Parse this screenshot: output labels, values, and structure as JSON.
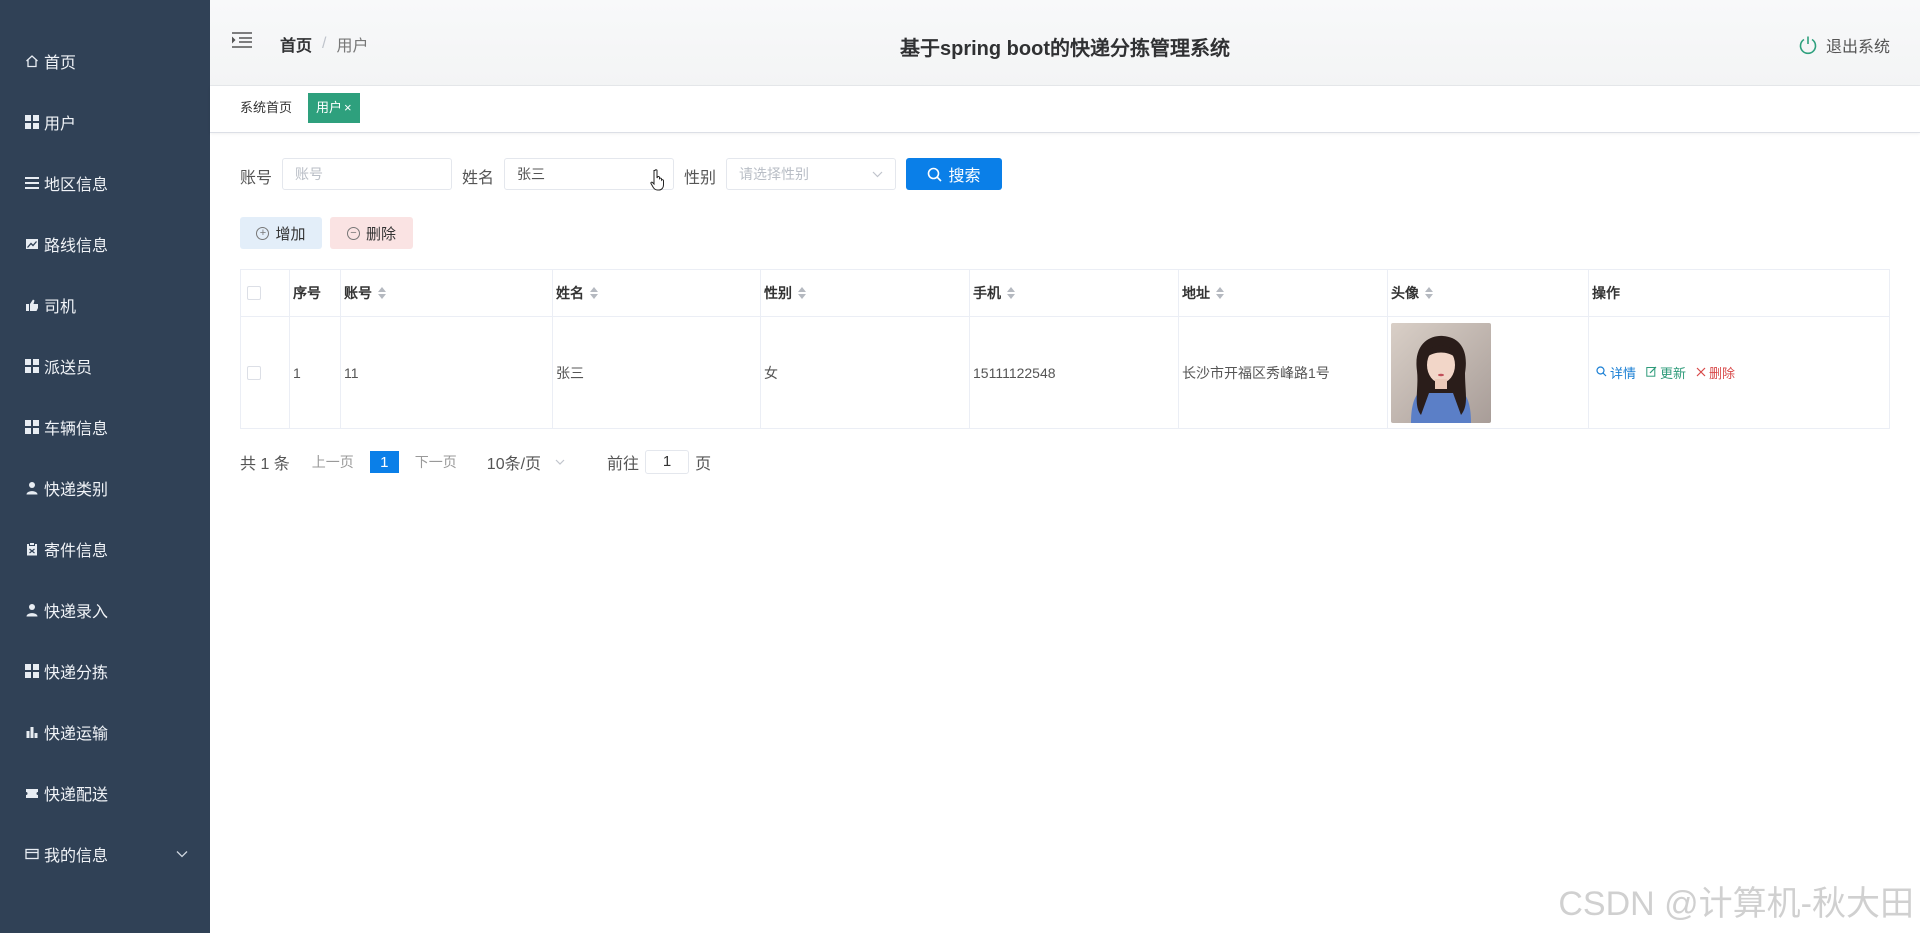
{
  "sidebar": {
    "items": [
      {
        "label": "首页",
        "icon": "home-icon"
      },
      {
        "label": "用户",
        "icon": "grid-icon"
      },
      {
        "label": "地区信息",
        "icon": "list-icon"
      },
      {
        "label": "路线信息",
        "icon": "picture-icon"
      },
      {
        "label": "司机",
        "icon": "thumb-icon"
      },
      {
        "label": "派送员",
        "icon": "grid-icon"
      },
      {
        "label": "车辆信息",
        "icon": "grid-icon"
      },
      {
        "label": "快递类别",
        "icon": "user-icon"
      },
      {
        "label": "寄件信息",
        "icon": "clipboard-icon"
      },
      {
        "label": "快递录入",
        "icon": "user-icon"
      },
      {
        "label": "快递分拣",
        "icon": "grid-icon"
      },
      {
        "label": "快递运输",
        "icon": "bar-chart-icon"
      },
      {
        "label": "快递配送",
        "icon": "ticket-icon"
      },
      {
        "label": "我的信息",
        "icon": "card-icon"
      }
    ]
  },
  "header": {
    "breadcrumb_home": "首页",
    "breadcrumb_separator": "/",
    "breadcrumb_current": "用户",
    "title": "基于spring boot的快递分拣管理系统",
    "logout_label": "退出系统"
  },
  "tags": {
    "home": "系统首页",
    "active": "用户",
    "active_close": "×"
  },
  "search": {
    "account_label": "账号",
    "account_placeholder": "账号",
    "name_label": "姓名",
    "name_value": "张三",
    "gender_label": "性别",
    "gender_placeholder": "请选择性别",
    "search_button": "搜索"
  },
  "actions": {
    "add_label": "增加",
    "delete_label": "删除"
  },
  "table": {
    "headers": [
      "序号",
      "账号",
      "姓名",
      "性别",
      "手机",
      "地址",
      "头像",
      "操作"
    ],
    "rows": [
      {
        "index": "1",
        "account": "11",
        "name": "张三",
        "gender": "女",
        "phone": "15111122548",
        "address": "长沙市开福区秀峰路1号",
        "op_detail": "详情",
        "op_update": "更新",
        "op_delete": "删除"
      }
    ]
  },
  "pagination": {
    "total": "共 1 条",
    "prev": "上一页",
    "current": "1",
    "next": "下一页",
    "page_size": "10条/页",
    "goto_prefix": "前往",
    "goto_value": "1",
    "goto_suffix": "页"
  },
  "watermark": "CSDN @计算机-秋大田",
  "colors": {
    "sidebar_bg": "#304156",
    "primary": "#0a7fe8",
    "tag_active": "#2ea07d",
    "danger": "#d84848"
  }
}
